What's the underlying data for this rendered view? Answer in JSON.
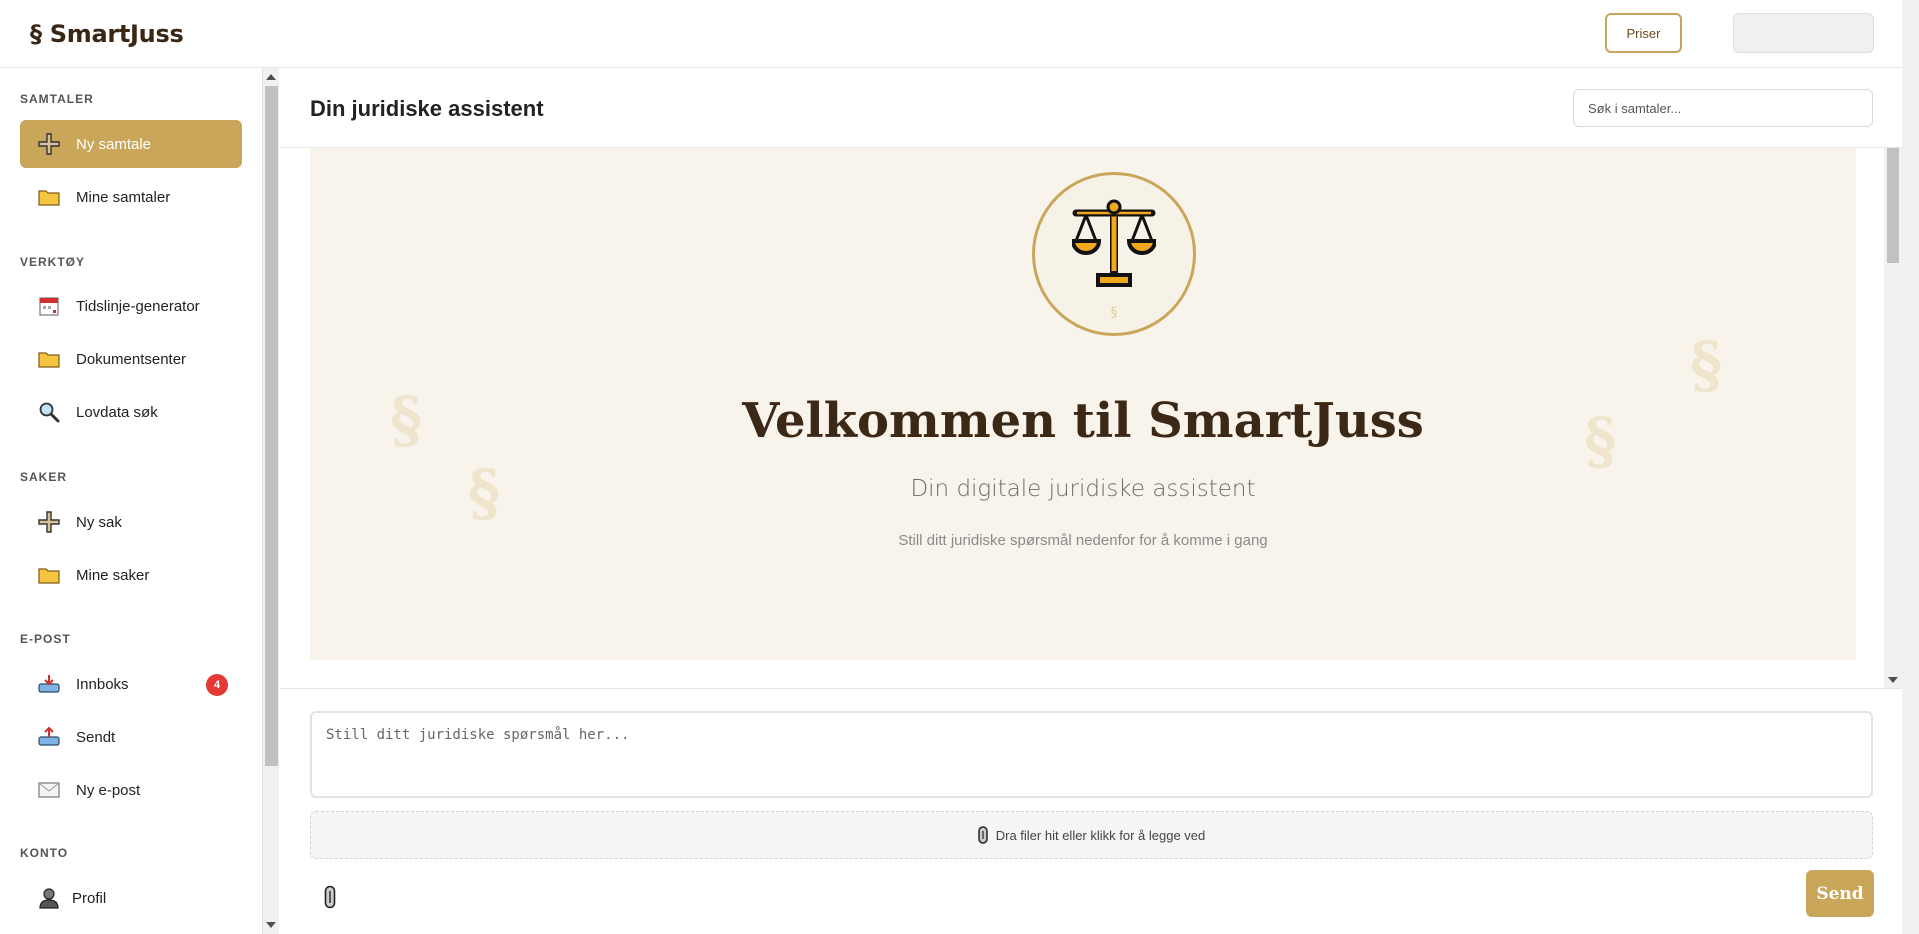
{
  "app": {
    "logo": "§ SmartJuss"
  },
  "topbar": {
    "pricing_label": "Priser"
  },
  "sidebar": {
    "sections": [
      {
        "title": "SAMTALER",
        "items": [
          {
            "label": "Ny samtale",
            "icon": "plus-icon",
            "active": true
          },
          {
            "label": "Mine samtaler",
            "icon": "folder-icon"
          }
        ]
      },
      {
        "title": "VERKTØY",
        "items": [
          {
            "label": "Tidslinje-generator",
            "icon": "calendar-icon"
          },
          {
            "label": "Dokumentsenter",
            "icon": "folder-icon"
          },
          {
            "label": "Lovdata søk",
            "icon": "magnifier-icon"
          }
        ]
      },
      {
        "title": "SAKER",
        "items": [
          {
            "label": "Ny sak",
            "icon": "plus-icon"
          },
          {
            "label": "Mine saker",
            "icon": "folder-icon"
          }
        ]
      },
      {
        "title": "E-POST",
        "items": [
          {
            "label": "Innboks",
            "icon": "inbox-icon",
            "badge": "4"
          },
          {
            "label": "Sendt",
            "icon": "outbox-icon"
          },
          {
            "label": "Ny e-post",
            "icon": "envelope-icon"
          }
        ]
      },
      {
        "title": "KONTO",
        "items": [
          {
            "label": "Profil",
            "icon": "user-icon"
          }
        ]
      }
    ]
  },
  "main": {
    "title": "Din juridiske assistent",
    "search_placeholder": "Søk i samtaler..."
  },
  "welcome": {
    "emblem_symbol": "§",
    "title": "Velkommen til SmartJuss",
    "subtitle": "Din digitale juridiske assistent",
    "hint": "Still ditt juridiske spørsmål nedenfor for å komme i gang",
    "decor_symbol": "§"
  },
  "composer": {
    "placeholder": "Still ditt juridiske spørsmål her...",
    "dropzone_label": "Dra filer hit eller klikk for å legge ved",
    "send_label": "Send"
  },
  "colors": {
    "accent": "#c9a65a",
    "brand_dark": "#3b2817",
    "badge": "#e53935",
    "welcome_bg": "#f8f4ec"
  }
}
